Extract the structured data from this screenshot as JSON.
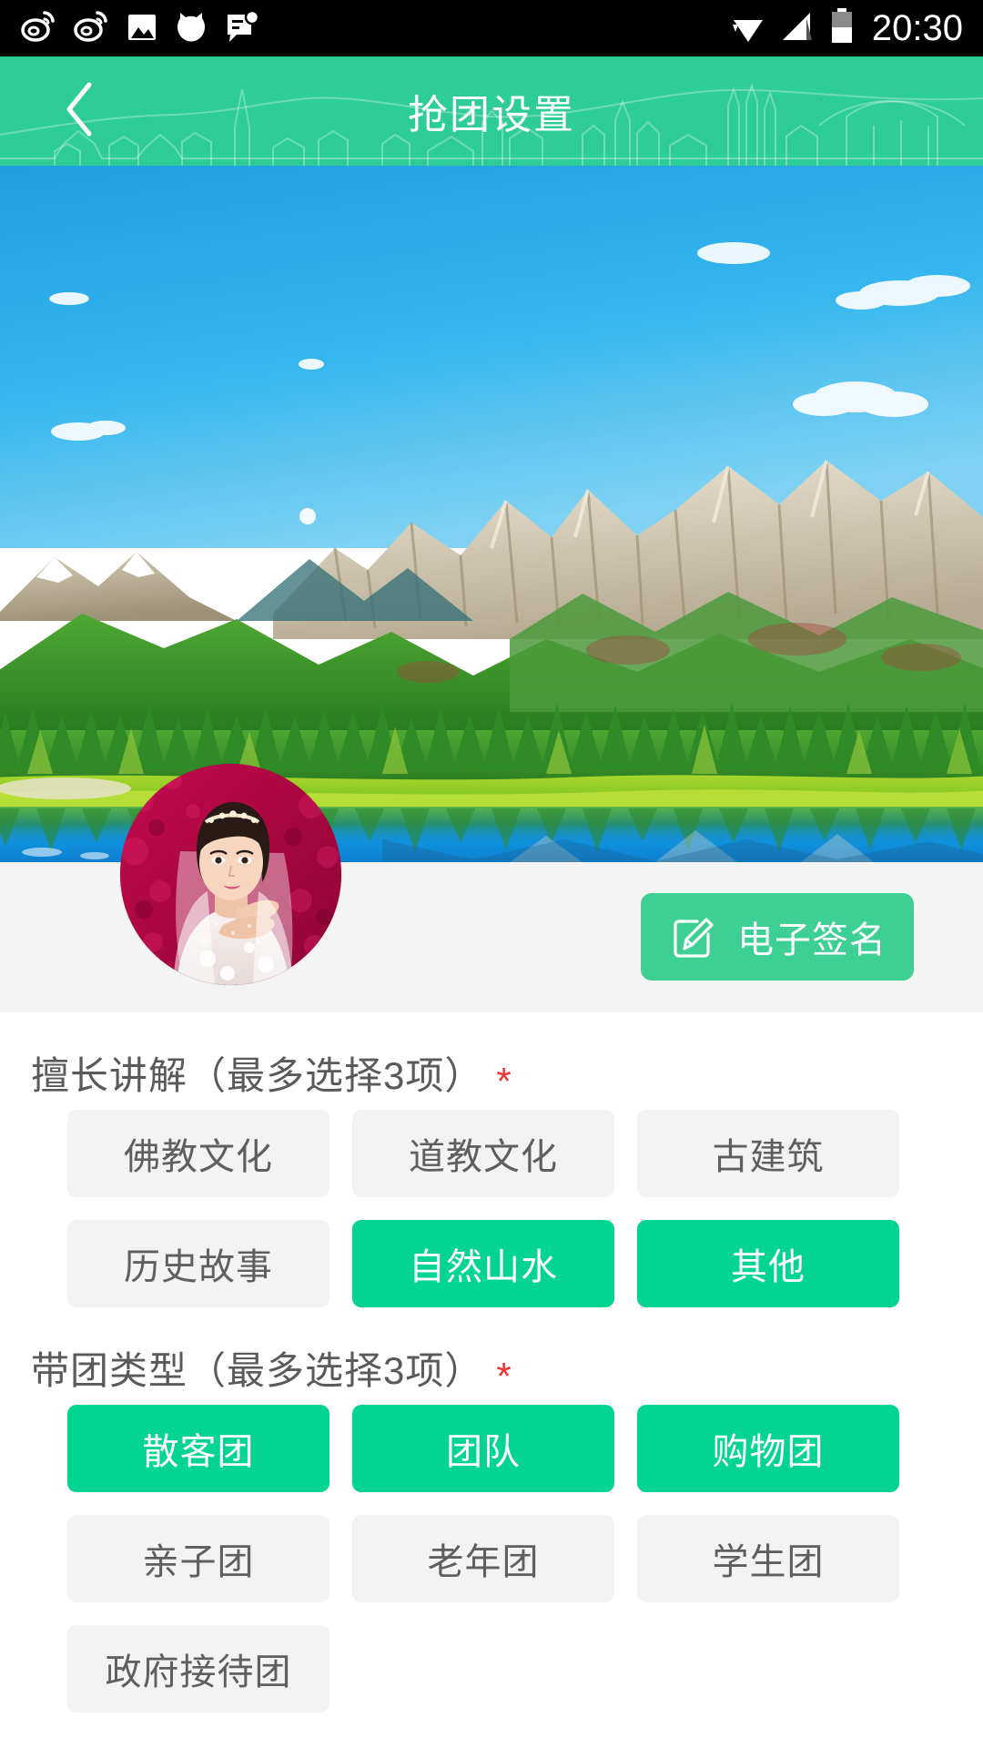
{
  "status_bar": {
    "time": "20:30",
    "left_icons": [
      "weibo-icon",
      "weibo-icon",
      "gallery-icon",
      "app-icon",
      "message-icon"
    ],
    "right_icons": [
      "wifi-icon",
      "signal-icon",
      "battery-icon"
    ]
  },
  "header": {
    "title": "抢团设置",
    "back_icon": "back-chevron-icon",
    "background_color": "#2ECC96"
  },
  "hero": {
    "alt": "mountain-lake-landscape"
  },
  "profile": {
    "avatar_alt": "user-avatar-bride-photo",
    "signature_button": {
      "label": "电子签名",
      "icon": "edit-pencil-icon",
      "color": "#3ECF94"
    }
  },
  "sections": [
    {
      "title": "擅长讲解（最多选择3项）",
      "required_mark": "*",
      "tags": [
        {
          "label": "佛教文化",
          "selected": false
        },
        {
          "label": "道教文化",
          "selected": false
        },
        {
          "label": "古建筑",
          "selected": false
        },
        {
          "label": "历史故事",
          "selected": false
        },
        {
          "label": "自然山水",
          "selected": true
        },
        {
          "label": "其他",
          "selected": true
        }
      ]
    },
    {
      "title": "带团类型（最多选择3项）",
      "required_mark": "*",
      "tags": [
        {
          "label": "散客团",
          "selected": true
        },
        {
          "label": "团队",
          "selected": true
        },
        {
          "label": "购物团",
          "selected": true
        },
        {
          "label": "亲子团",
          "selected": false
        },
        {
          "label": "老年团",
          "selected": false
        },
        {
          "label": "学生团",
          "selected": false
        },
        {
          "label": "政府接待团",
          "selected": false
        }
      ]
    }
  ],
  "colors": {
    "brand_green": "#2ECC96",
    "tag_selected_green": "#03D491",
    "tag_unselected_bg": "#F3F3F3",
    "required_red": "#F03232",
    "strip_bg": "#F4F4F4"
  }
}
